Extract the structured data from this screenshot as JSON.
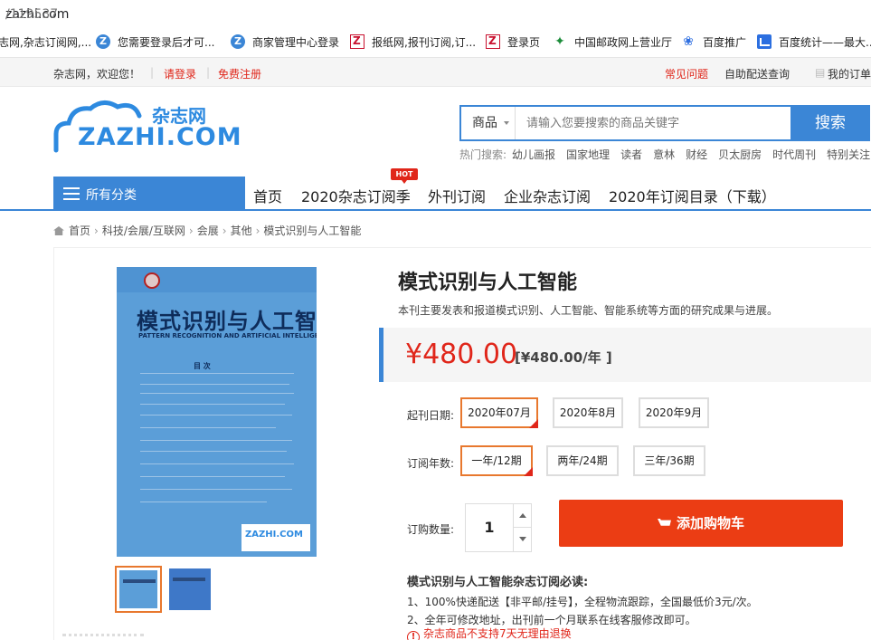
{
  "browser": {
    "url_host": "zazhi.com",
    "url_path": "/119537",
    "bookmarks": [
      {
        "icon": "zazhi-cloud-icon",
        "label": "志网,杂志订阅网,..."
      },
      {
        "icon": "zazhi-cloud-icon",
        "label": "您需要登录后才可..."
      },
      {
        "icon": "zazhi-cloud-icon",
        "label": "商家管理中心登录"
      },
      {
        "icon": "z-red-icon",
        "label": "报纸网,报刊订阅,订..."
      },
      {
        "icon": "z-red-icon",
        "label": "登录页"
      },
      {
        "icon": "post-office-icon",
        "label": "中国邮政网上营业厅"
      },
      {
        "icon": "baidu-paw-icon",
        "label": "百度推广"
      },
      {
        "icon": "stats-chart-icon",
        "label": "百度统计——最大..."
      }
    ]
  },
  "topbar": {
    "welcome": "杂志网，欢迎您！",
    "login": "请登录",
    "register": "免费注册",
    "faq": "常见问题",
    "pickup": "自助配送查询",
    "my_orders": "我的订单"
  },
  "header": {
    "logo_cn": "杂志网",
    "logo_en": "ZAZHI.COM",
    "search_category": "商品",
    "search_placeholder": "请输入您要搜索的商品关键字",
    "search_button": "搜索",
    "hot_label": "热门搜索:",
    "hot_keywords": [
      "幼儿画报",
      "国家地理",
      "读者",
      "意林",
      "财经",
      "贝太厨房",
      "时代周刊",
      "特别关注"
    ]
  },
  "nav": {
    "all_categories": "所有分类",
    "links": [
      "首页",
      "2020杂志订阅季",
      "外刊订阅",
      "企业杂志订阅",
      "2020年订阅目录（下载）"
    ],
    "hot_badge": "HOT"
  },
  "breadcrumb": [
    "首页",
    "科技/会展/互联网",
    "会展",
    "其他",
    "模式识别与人工智能"
  ],
  "product": {
    "cover_title": "模式识别与人工智能",
    "cover_subtitle": "PATTERN RECOGNITION AND ARTIFICIAL INTELLIGENCE",
    "cover_toc": "目 次",
    "title": "模式识别与人工智能",
    "description": "本刊主要发表和报道模式识别、人工智能、智能系统等方面的研究成果与进展。",
    "price": "¥480.00",
    "price_per_year": "[¥480.00/年 ]",
    "start_date_label": "起刊日期:",
    "start_dates": [
      "2020年07月",
      "2020年8月",
      "2020年9月"
    ],
    "selected_start_date": "2020年07月",
    "years_label": "订阅年数:",
    "years": [
      "一年/12期",
      "两年/24期",
      "三年/36期"
    ],
    "selected_years": "一年/12期",
    "qty_label": "订购数量:",
    "quantity": "1",
    "add_to_cart": "添加购物车",
    "notes_title": "模式识别与人工智能杂志订阅必读:",
    "notes": [
      "1、100%快递配送【非平邮/挂号】，全程物流跟踪，全国最低价3元/次。",
      "2、全年可修改地址，出刊前一个月联系在线客服修改即可。"
    ],
    "warning": "杂志商品不支持7天无理由退换"
  },
  "colors": {
    "brand_blue": "#3b86d6",
    "price_red": "#e0261a",
    "cart_orange": "#eb3d14",
    "selected_border": "#e8782e"
  }
}
